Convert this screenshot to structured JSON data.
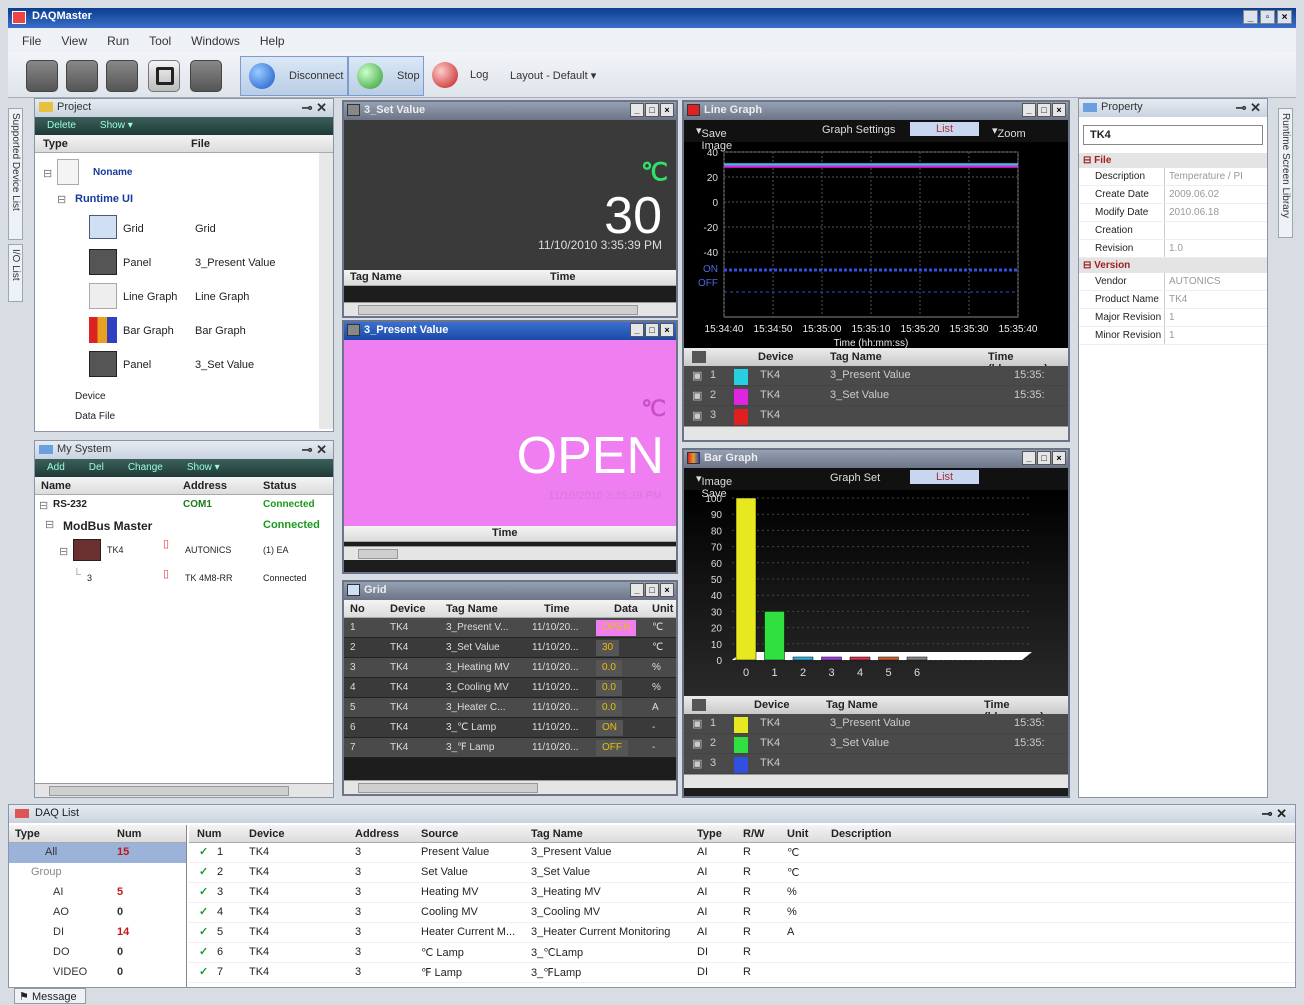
{
  "app": {
    "title": "DAQMaster",
    "win_buttons": [
      "_",
      "▫",
      "×"
    ]
  },
  "menu": [
    "File",
    "View",
    "Run",
    "Tool",
    "Windows",
    "Help"
  ],
  "toolbar": {
    "disconnect": "Disconnect",
    "stop": "Stop",
    "log": "Log",
    "layout": "Layout - Default"
  },
  "side_tabs_left": [
    "Supported Device List",
    "I/O List"
  ],
  "side_tabs_right": [
    "Runtime Screen Library"
  ],
  "project": {
    "title": "Project",
    "actions": [
      "Delete",
      "Show"
    ],
    "cols": [
      "Type",
      "File"
    ],
    "root": "Noname",
    "runtime": "Runtime UI",
    "items": [
      {
        "type": "Grid",
        "file": "Grid"
      },
      {
        "type": "Panel",
        "file": "3_Present Value"
      },
      {
        "type": "Line Graph",
        "file": "Line Graph"
      },
      {
        "type": "Bar Graph",
        "file": "Bar Graph"
      },
      {
        "type": "Panel",
        "file": "3_Set Value"
      }
    ],
    "device": "Device",
    "datafile": "Data File"
  },
  "mysystem": {
    "title": "My System",
    "actions": [
      "Add",
      "Del",
      "Change",
      "Show"
    ],
    "cols": [
      "Name",
      "Address",
      "Status"
    ],
    "rows": [
      {
        "name": "RS-232",
        "address": "COM1",
        "status": "Connected"
      },
      {
        "name": "ModBus Master",
        "address": "",
        "status": "Connected"
      },
      {
        "name": "TK4",
        "address": "AUTONICS",
        "status": "(1) EA"
      },
      {
        "name": "3",
        "address": "TK 4M8-RR",
        "status": "Connected"
      }
    ]
  },
  "setvalue": {
    "title": "3_Set Value",
    "unit": "℃",
    "value": "30",
    "time": "11/10/2010 3:35:39 PM",
    "cols": [
      "Tag Name",
      "Time"
    ]
  },
  "presentvalue": {
    "title": "3_Present Value",
    "unit": "℃",
    "value": "OPEN",
    "time": "11/10/2010 3:35:39 PM",
    "cols": [
      "Time"
    ]
  },
  "grid": {
    "title": "Grid",
    "cols": [
      "No",
      "Device",
      "Tag Name",
      "Time",
      "Data",
      "Unit"
    ],
    "rows": [
      [
        "1",
        "TK4",
        "3_Present V...",
        "11/10/20...",
        "OPEN",
        "℃"
      ],
      [
        "2",
        "TK4",
        "3_Set Value",
        "11/10/20...",
        "30",
        "℃"
      ],
      [
        "3",
        "TK4",
        "3_Heating MV",
        "11/10/20...",
        "0.0",
        "%"
      ],
      [
        "4",
        "TK4",
        "3_Cooling MV",
        "11/10/20...",
        "0.0",
        "%"
      ],
      [
        "5",
        "TK4",
        "3_Heater C...",
        "11/10/20...",
        "0.0",
        "A"
      ],
      [
        "6",
        "TK4",
        "3_℃ Lamp",
        "11/10/20...",
        "ON",
        "-"
      ],
      [
        "7",
        "TK4",
        "3_℉ Lamp",
        "11/10/20...",
        "OFF",
        "-"
      ]
    ]
  },
  "linegraph": {
    "title": "Line Graph",
    "toolbar": [
      "Save Image",
      "Graph Settings",
      "List",
      "Zoom"
    ],
    "yticks": [
      "40",
      "20",
      "0",
      "-20",
      "-40"
    ],
    "onoff": [
      "ON",
      "OFF"
    ],
    "xticks": [
      "15:34:40",
      "15:34:50",
      "15:35:00",
      "15:35:10",
      "15:35:20",
      "15:35:30",
      "15:35:40"
    ],
    "xlabel": "Time (hh:mm:ss)",
    "list_cols": [
      "Device",
      "Tag Name",
      "Time (hh:mm:ss)"
    ],
    "list_rows": [
      {
        "n": "1",
        "device": "TK4",
        "tag": "3_Present Value",
        "time": "15:35:",
        "color": "#26d0e0"
      },
      {
        "n": "2",
        "device": "TK4",
        "tag": "3_Set Value",
        "time": "15:35:",
        "color": "#e024e0"
      },
      {
        "n": "3",
        "device": "TK4",
        "tag": "",
        "time": "",
        "color": "#e02020"
      }
    ]
  },
  "bargraph": {
    "title": "Bar Graph",
    "toolbar": [
      "Image Save",
      "Graph Set",
      "List"
    ],
    "list_cols": [
      "Device",
      "Tag Name",
      "Time (hh:mm:ss)"
    ],
    "list_rows": [
      {
        "n": "1",
        "device": "TK4",
        "tag": "3_Present Value",
        "time": "15:35:",
        "color": "#e8e820"
      },
      {
        "n": "2",
        "device": "TK4",
        "tag": "3_Set Value",
        "time": "15:35:",
        "color": "#30e040"
      },
      {
        "n": "3",
        "device": "TK4",
        "tag": "",
        "time": "",
        "color": "#3050e0"
      }
    ]
  },
  "chart_data": [
    {
      "type": "line",
      "x": [
        "15:34:40",
        "15:34:50",
        "15:35:00",
        "15:35:10",
        "15:35:20",
        "15:35:30",
        "15:35:40"
      ],
      "xlabel": "Time (hh:mm:ss)",
      "ylim": [
        -40,
        40
      ],
      "yticks": [
        40,
        20,
        0,
        -20,
        -40
      ],
      "series": [
        {
          "name": "3_Present Value",
          "values": [
            30,
            30,
            30,
            30,
            30,
            30,
            30
          ]
        },
        {
          "name": "3_Set Value",
          "values": [
            30,
            30,
            30,
            30,
            30,
            30,
            30
          ]
        }
      ]
    },
    {
      "type": "bar",
      "categories": [
        "0",
        "1",
        "2",
        "3",
        "4",
        "5",
        "6"
      ],
      "ylim": [
        0,
        100
      ],
      "yticks": [
        0,
        10,
        20,
        30,
        40,
        50,
        60,
        70,
        80,
        90,
        100
      ],
      "values": [
        100,
        30,
        0,
        0,
        0,
        0,
        0
      ],
      "colors": [
        "#e8e820",
        "#30e040",
        "#30b0e0",
        "#a040e0",
        "#e03050",
        "#d06030",
        "#888888"
      ]
    }
  ],
  "property": {
    "title": "Property",
    "object": "TK4",
    "sections": [
      {
        "name": "File",
        "rows": [
          [
            "Description",
            "Temperature / PI"
          ],
          [
            "Create Date",
            "2009.06.02"
          ],
          [
            "Modify Date",
            "2010.06.18"
          ],
          [
            "Creation",
            ""
          ],
          [
            "Revision",
            "1.0"
          ]
        ]
      },
      {
        "name": "Version",
        "rows": [
          [
            "Vendor",
            "AUTONICS"
          ],
          [
            "Product Name",
            "TK4"
          ],
          [
            "Major Revision",
            "1"
          ],
          [
            "Minor Revision",
            "1"
          ]
        ]
      }
    ]
  },
  "daqlist": {
    "title": "DAQ List",
    "left_cols": [
      "Type",
      "Num"
    ],
    "left_rows": [
      [
        "All",
        "15"
      ],
      [
        "Group",
        ""
      ],
      [
        "AI",
        "5"
      ],
      [
        "AO",
        "0"
      ],
      [
        "DI",
        "14"
      ],
      [
        "DO",
        "0"
      ],
      [
        "VIDEO",
        "0"
      ]
    ],
    "cols": [
      "Num",
      "Device",
      "Address",
      "Source",
      "Tag Name",
      "Type",
      "R/W",
      "Unit",
      "Description"
    ],
    "rows": [
      [
        "1",
        "TK4",
        "3",
        "Present Value",
        "3_Present Value",
        "AI",
        "R",
        "℃",
        ""
      ],
      [
        "2",
        "TK4",
        "3",
        "Set Value",
        "3_Set Value",
        "AI",
        "R",
        "℃",
        ""
      ],
      [
        "3",
        "TK4",
        "3",
        "Heating MV",
        "3_Heating MV",
        "AI",
        "R",
        "%",
        ""
      ],
      [
        "4",
        "TK4",
        "3",
        "Cooling MV",
        "3_Cooling MV",
        "AI",
        "R",
        "%",
        ""
      ],
      [
        "5",
        "TK4",
        "3",
        "Heater Current M...",
        "3_Heater Current Monitoring",
        "AI",
        "R",
        "A",
        ""
      ],
      [
        "6",
        "TK4",
        "3",
        "℃ Lamp",
        "3_℃Lamp",
        "DI",
        "R",
        "",
        ""
      ],
      [
        "7",
        "TK4",
        "3",
        "℉ Lamp",
        "3_℉Lamp",
        "DI",
        "R",
        "",
        ""
      ]
    ]
  },
  "message_tab": "Message",
  "colors": {
    "title": "#0b3d8f",
    "panel_bg": "#1d1d1d",
    "present_bg": "#ef7ef0",
    "accent_green": "#2fe06a"
  }
}
